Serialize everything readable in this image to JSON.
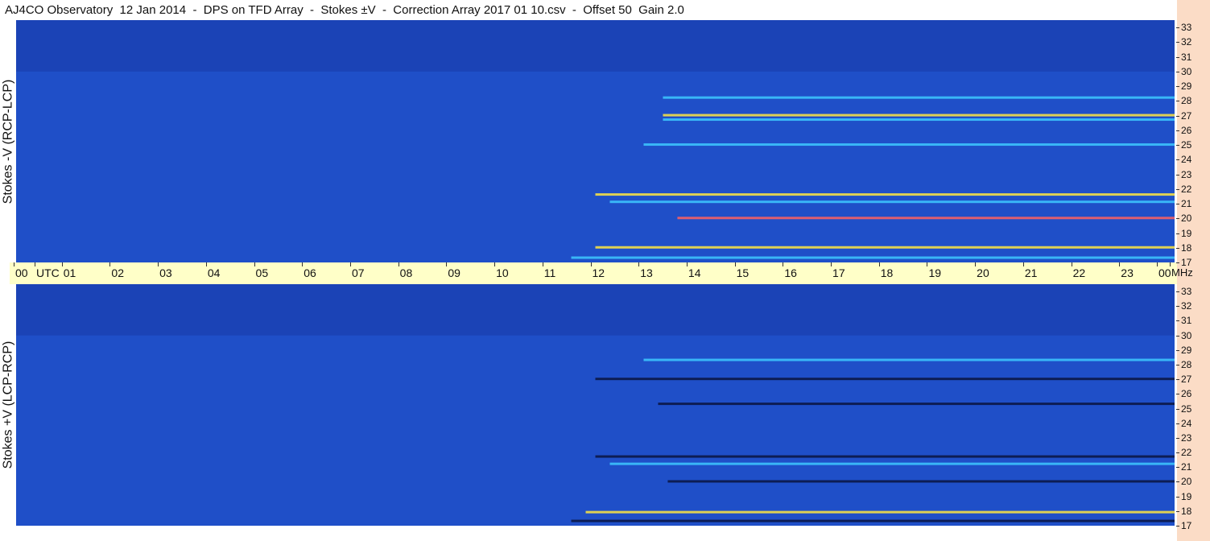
{
  "title": "AJ4CO Observatory  12 Jan 2014  -  DPS on TFD Array  -  Stokes ±V  -  Correction Array 2017 01 10.csv  -  Offset 50  Gain 2.0",
  "colors": {
    "background": "#1f4fc8",
    "time_bar": "#ffffc8",
    "freq_strip": "#fbdcc6",
    "emission_bright": "#3ec8ff",
    "emission_hot": "#ffe640",
    "emission_peak": "#ff6060",
    "absorption": "#0a1440"
  },
  "chart_data": [
    {
      "type": "heatmap",
      "panel": "top",
      "ylabel": "Stokes -V (RCP-LCP)",
      "x_ticks": [
        "00",
        "01",
        "02",
        "03",
        "04",
        "05",
        "06",
        "07",
        "08",
        "09",
        "10",
        "11",
        "12",
        "13",
        "14",
        "15",
        "16",
        "17",
        "18",
        "19",
        "20",
        "21",
        "22",
        "23",
        "00"
      ],
      "x_unit_label": "UTC",
      "y_unit_label": "MHz",
      "y_ticks": [
        33,
        32,
        31,
        30,
        29,
        28,
        27,
        26,
        25,
        24,
        23,
        22,
        21,
        20,
        19,
        18,
        17
      ],
      "xlim": [
        0,
        24
      ],
      "ylim": [
        17,
        33.5
      ],
      "features": [
        {
          "freq": 27.0,
          "start_utc": 13.4,
          "end_utc": 24,
          "level": "hot"
        },
        {
          "freq": 26.7,
          "start_utc": 13.4,
          "end_utc": 24,
          "level": "bright"
        },
        {
          "freq": 28.2,
          "start_utc": 13.4,
          "end_utc": 24,
          "level": "bright"
        },
        {
          "freq": 21.6,
          "start_utc": 12.0,
          "end_utc": 24,
          "level": "hot"
        },
        {
          "freq": 21.1,
          "start_utc": 12.3,
          "end_utc": 24,
          "level": "bright"
        },
        {
          "freq": 20.0,
          "start_utc": 13.7,
          "end_utc": 24,
          "level": "peak"
        },
        {
          "freq": 18.0,
          "start_utc": 12.0,
          "end_utc": 24,
          "level": "hot"
        },
        {
          "freq": 17.3,
          "start_utc": 11.5,
          "end_utc": 24,
          "level": "bright"
        },
        {
          "freq": 25.0,
          "start_utc": 13.0,
          "end_utc": 24,
          "level": "bright"
        }
      ]
    },
    {
      "type": "heatmap",
      "panel": "bottom",
      "ylabel": "Stokes +V (LCP-RCP)",
      "x_ticks": [
        "00",
        "01",
        "02",
        "03",
        "04",
        "05",
        "06",
        "07",
        "08",
        "09",
        "10",
        "11",
        "12",
        "13",
        "14",
        "15",
        "16",
        "17",
        "18",
        "19",
        "20",
        "21",
        "22",
        "23",
        "00"
      ],
      "y_ticks": [
        33,
        32,
        31,
        30,
        29,
        28,
        27,
        26,
        25,
        24,
        23,
        22,
        21,
        20,
        19,
        18,
        17
      ],
      "xlim": [
        0,
        24
      ],
      "ylim": [
        17,
        33.5
      ],
      "features": [
        {
          "freq": 27.0,
          "start_utc": 12.0,
          "end_utc": 24,
          "level": "absorption"
        },
        {
          "freq": 25.3,
          "start_utc": 13.3,
          "end_utc": 24,
          "level": "absorption"
        },
        {
          "freq": 28.3,
          "start_utc": 13.0,
          "end_utc": 24,
          "level": "bright"
        },
        {
          "freq": 21.7,
          "start_utc": 12.0,
          "end_utc": 24,
          "level": "absorption"
        },
        {
          "freq": 21.2,
          "start_utc": 12.3,
          "end_utc": 24,
          "level": "bright"
        },
        {
          "freq": 20.0,
          "start_utc": 13.5,
          "end_utc": 24,
          "level": "absorption"
        },
        {
          "freq": 17.9,
          "start_utc": 11.8,
          "end_utc": 24,
          "level": "hot"
        },
        {
          "freq": 17.3,
          "start_utc": 11.5,
          "end_utc": 24,
          "level": "absorption"
        }
      ]
    }
  ]
}
